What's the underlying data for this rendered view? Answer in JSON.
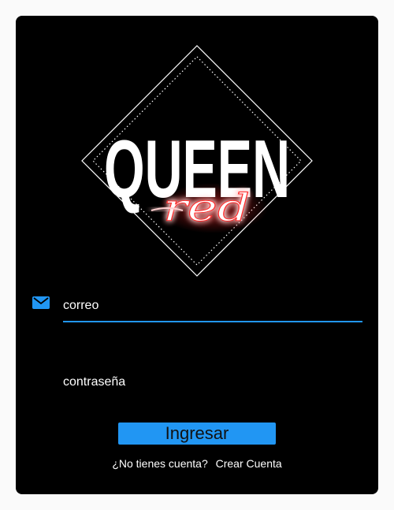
{
  "logo": {
    "wordmark": "QUEEN",
    "script": "red"
  },
  "login_form": {
    "email_placeholder": "correo",
    "password_placeholder": "contraseña",
    "email_icon": "mail-icon",
    "submit_label": "Ingresar"
  },
  "signup": {
    "prompt": "¿No tienes cuenta?",
    "link_label": "Crear Cuenta"
  },
  "colors": {
    "accent": "#2196f3",
    "card_background": "#000000",
    "page_background": "#fafafa",
    "neon_red": "#ff2a2a"
  }
}
